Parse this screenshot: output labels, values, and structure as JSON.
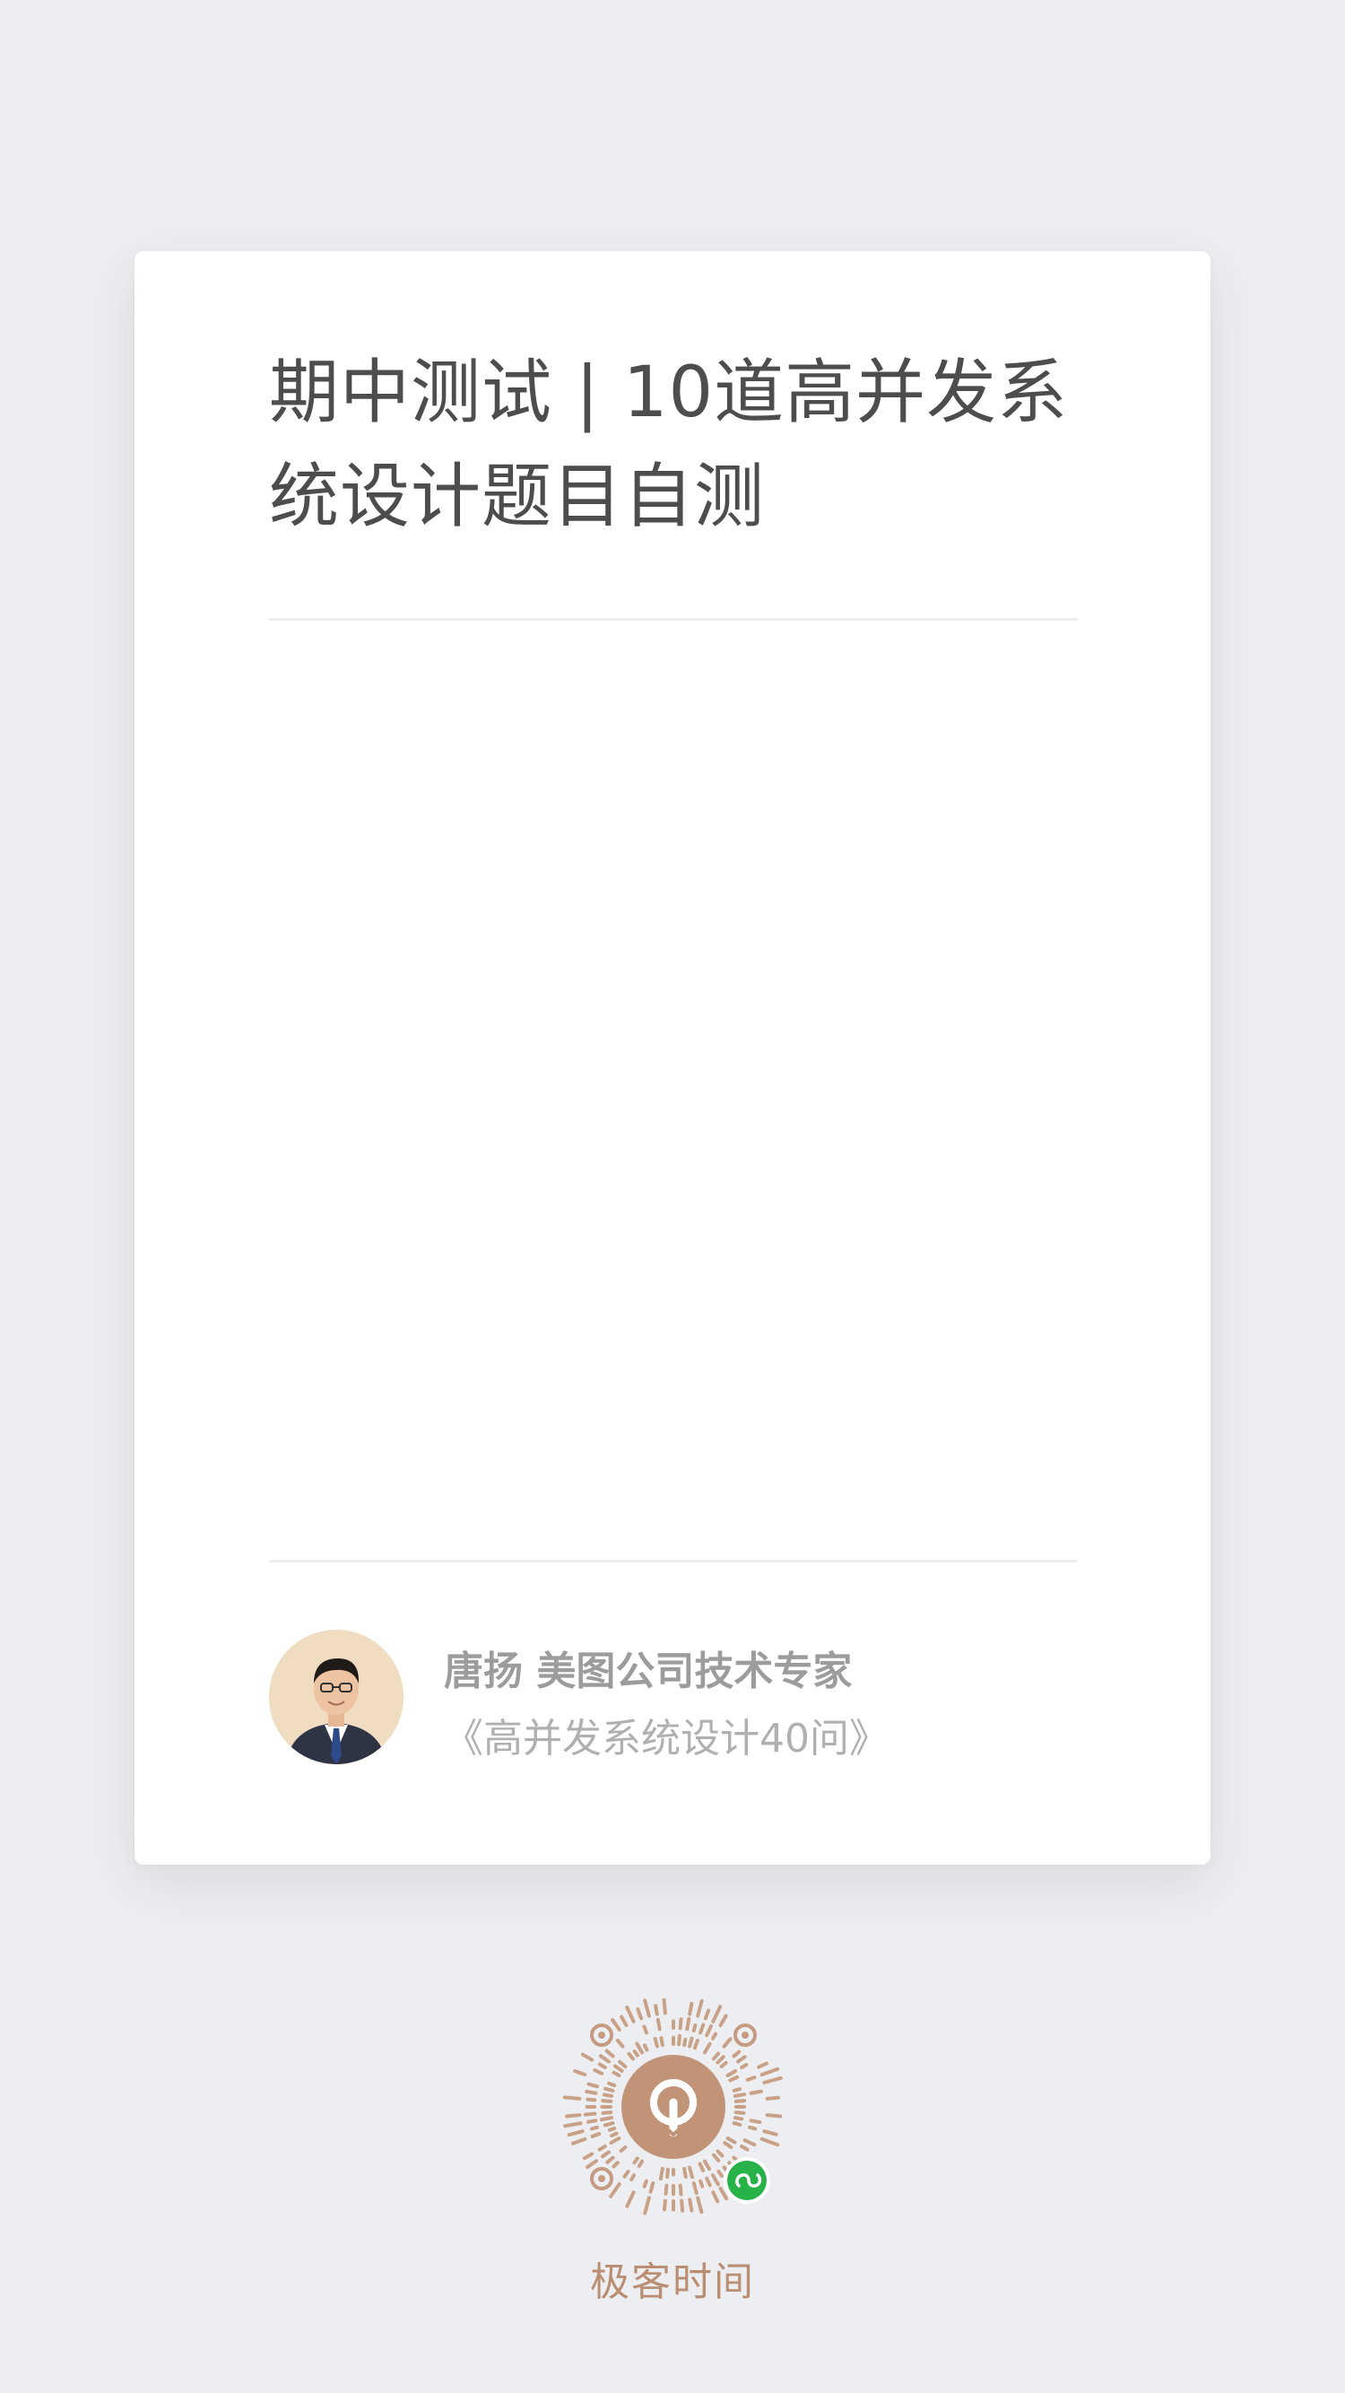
{
  "card": {
    "title": "期中测试 | 10道高并发系统设计题目自测",
    "author_line": "唐扬  美图公司技术专家",
    "course": "《高并发系统设计40问》"
  },
  "footer": {
    "brand": "极客时间"
  },
  "colors": {
    "background": "#edeef1",
    "card": "#ffffff",
    "title_text": "#4d4d4d",
    "brand": "#b98e72",
    "miniprogram_badge": "#28b34a"
  },
  "icons": {
    "qrcode": "mini-program-code-icon",
    "badge": "mini-program-link-icon",
    "avatar": "author-photo"
  }
}
